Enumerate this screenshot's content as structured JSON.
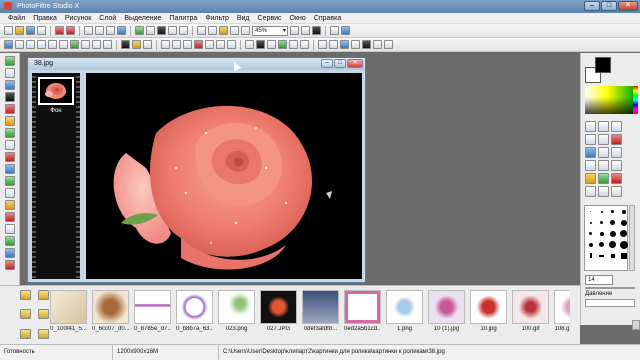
{
  "window": {
    "title": "PhotoFiltre Studio X"
  },
  "menu": [
    "Файл",
    "Правка",
    "Рисунок",
    "Слой",
    "Выделение",
    "Палитра",
    "Фильтр",
    "Вид",
    "Сервис",
    "Окно",
    "Справка"
  ],
  "toolbar": {
    "zoom_value": "45%"
  },
  "document": {
    "title": "38.jpg",
    "layer_label": "Фон"
  },
  "right_panel": {
    "brush_size": "14",
    "pressure_label": "Давление"
  },
  "thumbnails": [
    {
      "label": "0_100f41_5..."
    },
    {
      "label": "0_6cc07_d0..."
    },
    {
      "label": "0_8785e_d7..."
    },
    {
      "label": "0_b8b7a_63..."
    },
    {
      "label": "023.png"
    },
    {
      "label": "027.JPG"
    },
    {
      "label": "0def3afdf8..."
    },
    {
      "label": "0ed2a5b1cd..."
    },
    {
      "label": "1.png"
    },
    {
      "label": "10 (1).jpg"
    },
    {
      "label": "10.jpg"
    },
    {
      "label": "100.gif"
    },
    {
      "label": "108.g"
    }
  ],
  "status": {
    "state": "Готовность",
    "dimensions": "1200x900x16M",
    "path": "C:\\Users\\User\\Desktop\\клипарт2\\картинки для ролика\\картинки к роликам\\38.jpg"
  }
}
